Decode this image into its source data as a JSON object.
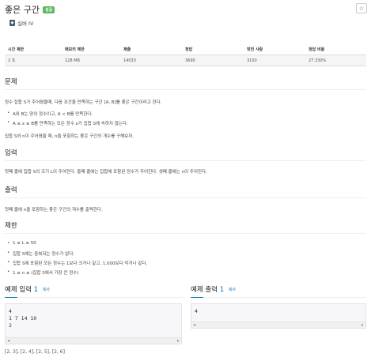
{
  "header": {
    "title": "좋은 구간",
    "badge": "성공",
    "star": "☆",
    "tier": "실버 IV"
  },
  "info": {
    "headers": [
      "시간 제한",
      "메모리 제한",
      "제출",
      "정답",
      "맞힌 사람",
      "정답 비율"
    ],
    "values": [
      "2 초",
      "128 MB",
      "14033",
      "3690",
      "3150",
      "27.330%"
    ]
  },
  "problem": {
    "heading": "문제",
    "intro": "정수 집합 S가 주어졌을때, 다음 조건을 만족하는 구간 [A, B]를 좋은 구간이라고 한다.",
    "bullets": [
      "A와 B는 양의 정수이고, A < B를 만족한다.",
      "A ≤ x ≤ B를 만족하는 모든 정수 x가 집합 S에 속하지 않는다."
    ],
    "outro": "집합 S와 n이 주어졌을 때, n을 포함하는 좋은 구간의 개수를 구해보자."
  },
  "input": {
    "heading": "입력",
    "text": "첫째 줄에 집합 S의 크기 L이 주어진다. 둘째 줄에는 집합에 포함된 정수가 주어진다. 셋째 줄에는 n이 주어진다."
  },
  "output": {
    "heading": "출력",
    "text": "첫째 줄에 n을 포함하는 좋은 구간의 개수를 출력한다."
  },
  "limits": {
    "heading": "제한",
    "bullets": [
      "1 ≤ L ≤ 50",
      "집합 S에는 중복되는 정수가 없다.",
      "집합 S에 포함된 모든 정수는 1보다 크거나 같고, 1,000보다 작거나 같다.",
      "1 ≤ n ≤ (집합 S에서 가장 큰 정수)"
    ]
  },
  "sample_input": {
    "label": "예제 입력",
    "num": "1",
    "copy": "복사",
    "lines": [
      "4",
      "1 7 14 10",
      "2"
    ]
  },
  "sample_output": {
    "label": "예제 출력",
    "num": "1",
    "copy": "복사",
    "lines": [
      "4"
    ]
  },
  "note": "[2, 3], [2, 4], [2, 5], [2, 6]"
}
